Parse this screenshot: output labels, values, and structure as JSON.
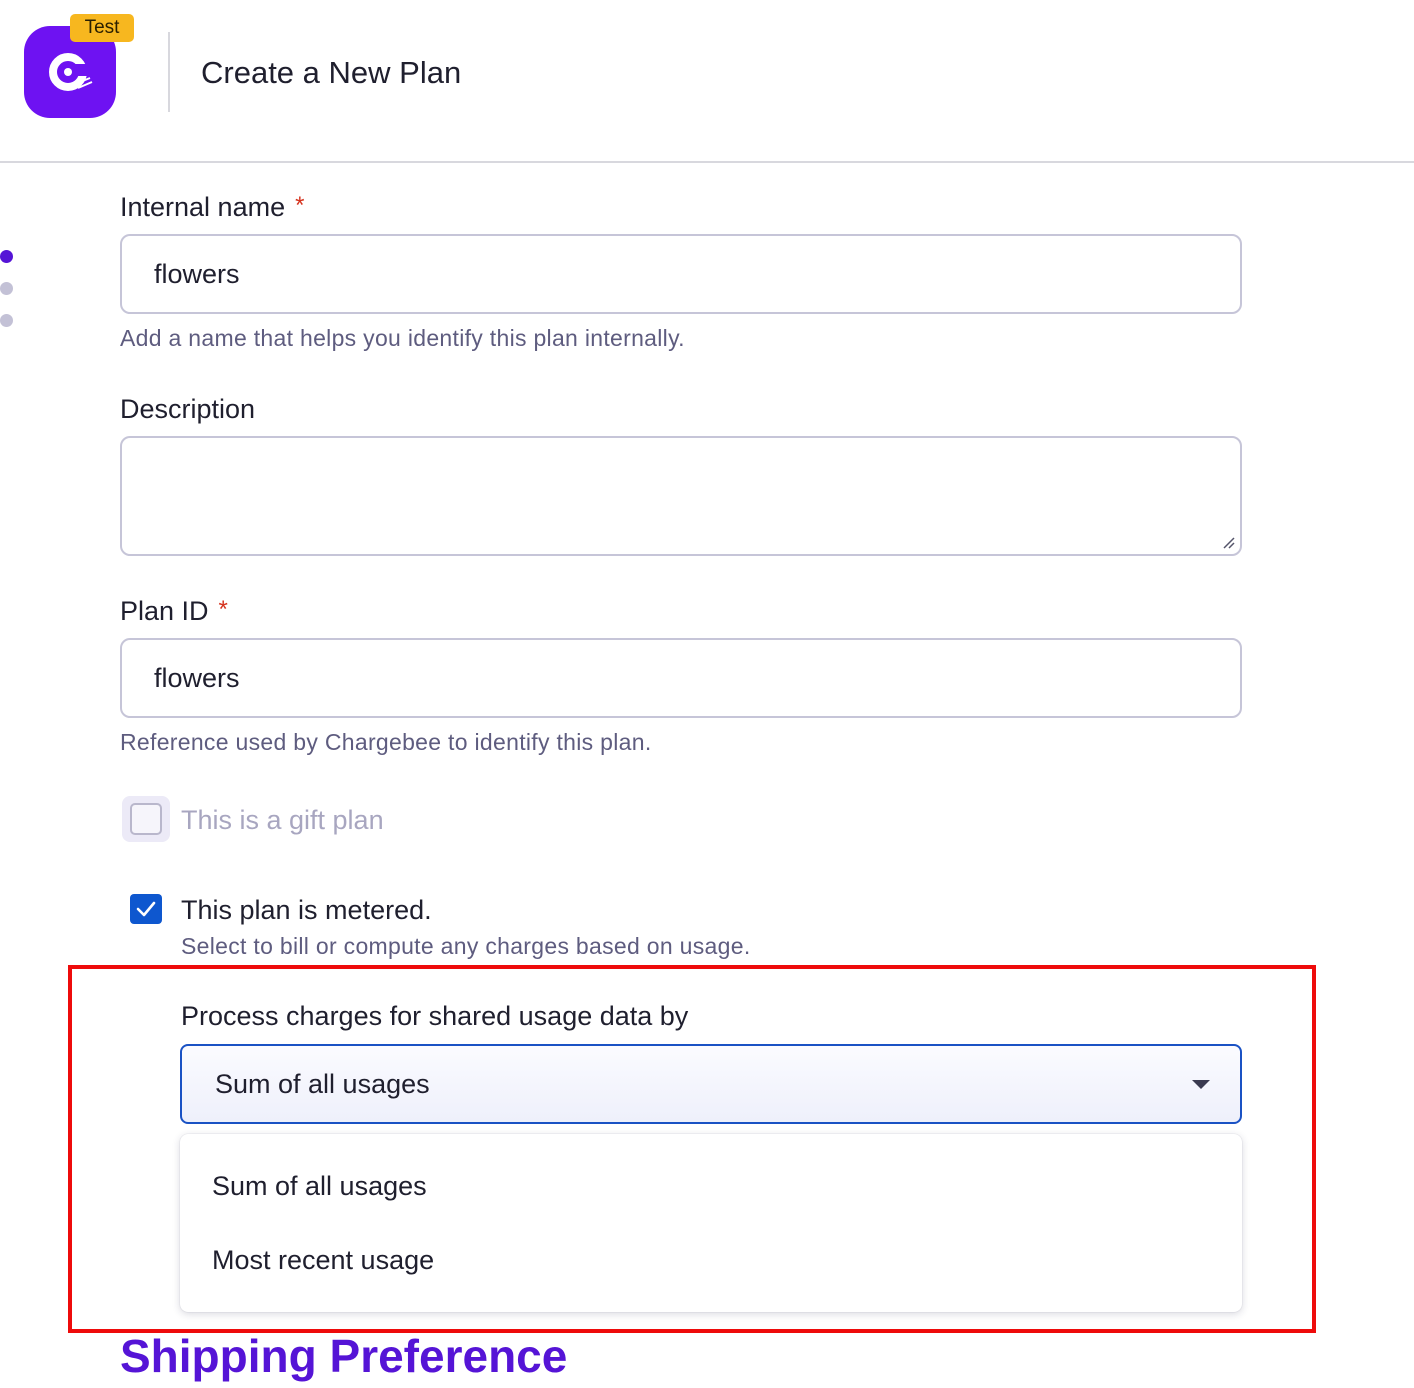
{
  "header": {
    "badge": "Test",
    "title": "Create a New Plan",
    "logo_icon": "chargebee-logo-icon",
    "logo_color": "#6e12f2",
    "badge_color": "#f7b71f"
  },
  "steps": {
    "active_color": "#5514d6",
    "inactive_color": "#c3c1d6"
  },
  "form": {
    "internal_name": {
      "label": "Internal name",
      "required_mark": "*",
      "value": "flowers",
      "help": "Add a name that helps you identify this plan internally."
    },
    "description": {
      "label": "Description",
      "value": ""
    },
    "plan_id": {
      "label": "Plan ID",
      "required_mark": "*",
      "value": "flowers",
      "help": "Reference used by Chargebee to identify this plan."
    },
    "gift_plan": {
      "label": "This is a gift plan",
      "checked": false,
      "disabled": true
    },
    "metered": {
      "label": "This plan is metered.",
      "checked": true,
      "help": "Select to bill or compute any charges based on usage."
    },
    "process_charges": {
      "label": "Process charges for shared usage data by",
      "selected": "Sum of all usages",
      "options": [
        "Sum of all usages",
        "Most recent usage"
      ]
    }
  },
  "sections": {
    "shipping_heading": "Shipping Preference"
  },
  "colors": {
    "accent": "#5514d6",
    "select_border": "#1a52c4",
    "checkbox_checked": "#0e57cf",
    "required": "#d5331e",
    "highlight": "#ee0b0b"
  }
}
